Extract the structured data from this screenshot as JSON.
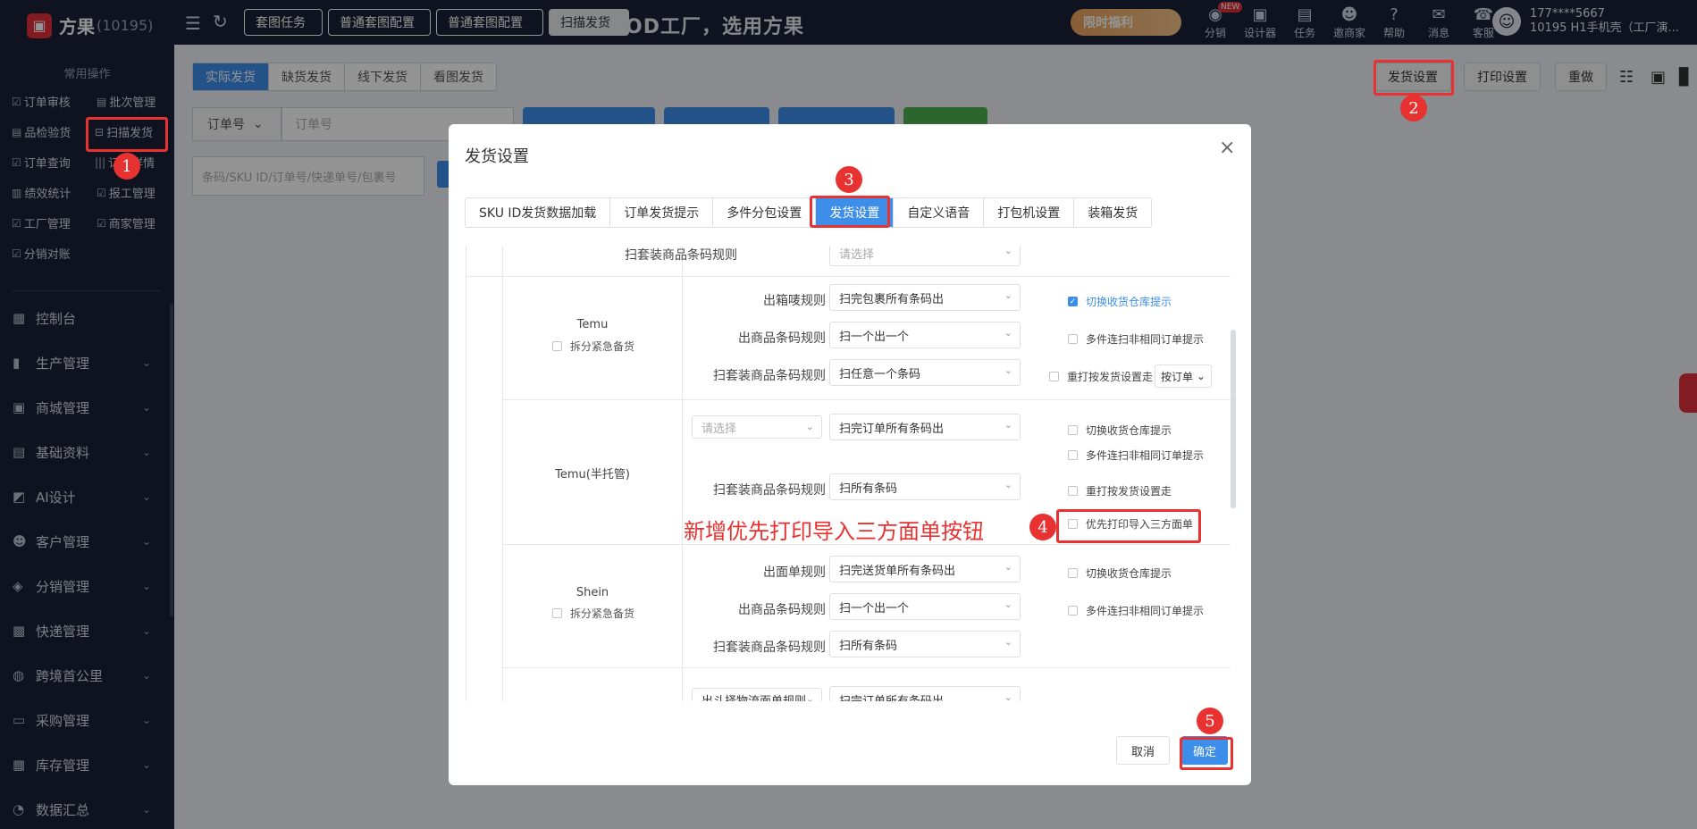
{
  "app": {
    "logo_mark": "▣",
    "name": "方果",
    "account_id": "(10195)"
  },
  "top_tabs": [
    "套图任务",
    "普通套图配置",
    "普通套图配置",
    "扫描发货"
  ],
  "banner": "OD工厂，选用方果",
  "promo": "限时福利",
  "top_icons": [
    {
      "icon": "share-icon",
      "glyph": "◉",
      "label": "分销",
      "badge": "NEW"
    },
    {
      "icon": "designer-icon",
      "glyph": "▣",
      "label": "设计器"
    },
    {
      "icon": "task-icon",
      "glyph": "▤",
      "label": "任务"
    },
    {
      "icon": "invite-icon",
      "glyph": "☻",
      "label": "邀商家"
    },
    {
      "icon": "help-icon",
      "glyph": "?",
      "label": "帮助"
    },
    {
      "icon": "message-icon",
      "glyph": "✉",
      "label": "消息"
    },
    {
      "icon": "service-icon",
      "glyph": "☎",
      "label": "客服"
    }
  ],
  "user": {
    "phone": "177****5667",
    "org": "10195  H1手机壳（工厂演..."
  },
  "sidebar": {
    "section_title": "常用操作",
    "quick": [
      "订单审核",
      "批次管理",
      "品检验货",
      "扫描发货",
      "订单查询",
      "订单详情",
      "绩效统计",
      "报工管理",
      "工厂管理",
      "商家管理",
      "分销对账"
    ],
    "menu": [
      "控制台",
      "生产管理",
      "商城管理",
      "基础资料",
      "AI设计",
      "客户管理",
      "分销管理",
      "快递管理",
      "跨境首公里",
      "采购管理",
      "库存管理",
      "数据汇总"
    ]
  },
  "page": {
    "segments": [
      "实际发货",
      "缺货发货",
      "线下发货",
      "看图发货"
    ],
    "order_type": "订单号",
    "order_placeholder": "订单号",
    "barcode_placeholder": "条码/SKU ID/订单号/快递单号/包裹号",
    "right_buttons": [
      "发货设置",
      "打印设置",
      "重做"
    ]
  },
  "modal": {
    "title": "发货设置",
    "close": "×",
    "tabs": [
      "SKU ID发货数据加载",
      "订单发货提示",
      "多件分包设置",
      "发货设置",
      "自定义语音",
      "打包机设置",
      "装箱发货"
    ],
    "top_row": {
      "label": "扫套装商品条码规则",
      "placeholder": "请选择"
    },
    "temu": {
      "name": "Temu",
      "split": "拆分紧急备货",
      "rows": [
        {
          "label": "出箱唛规则",
          "value": "扫完包裹所有条码出"
        },
        {
          "label": "出商品条码规则",
          "value": "扫一个出一个"
        },
        {
          "label": "扫套装商品条码规则",
          "value": "扫任意一个条码"
        }
      ],
      "options": [
        {
          "label": "切换收货仓库提示",
          "checked": true
        },
        {
          "label": "多件连扫非相同订单提示",
          "checked": false
        },
        {
          "label": "重打按发货设置走",
          "checked": false
        }
      ],
      "reprint_mode": "按订单"
    },
    "temu_semi": {
      "name": "Temu(半托管)",
      "rows": [
        {
          "label": "请选择",
          "value": "扫完订单所有条码出"
        },
        {
          "label": "扫套装商品条码规则",
          "value": "扫所有条码"
        }
      ],
      "options": [
        "切换收货仓库提示",
        "多件连扫非相同订单提示",
        "重打按发货设置走",
        "优先打印导入三方面单"
      ]
    },
    "shein": {
      "name": "Shein",
      "split": "拆分紧急备货",
      "rows": [
        {
          "label": "出面单规则",
          "value": "扫完送货单所有条码出"
        },
        {
          "label": "出商品条码规则",
          "value": "扫一个出一个"
        },
        {
          "label": "扫套装商品条码规则",
          "value": "扫所有条码"
        }
      ],
      "options": [
        "切换收货仓库提示",
        "多件连扫非相同订单提示"
      ]
    },
    "last_row": {
      "label": "出斗择物流面单规则",
      "value": "扫完订单所有条码出"
    },
    "note": "新增优先打印导入三方面单按钮",
    "cancel": "取消",
    "confirm": "确定"
  },
  "markers": [
    "1",
    "2",
    "3",
    "4",
    "5"
  ],
  "colors": {
    "accent": "#3c8ee8",
    "annotation": "#e83232",
    "nav_bg": "#1a2136"
  }
}
